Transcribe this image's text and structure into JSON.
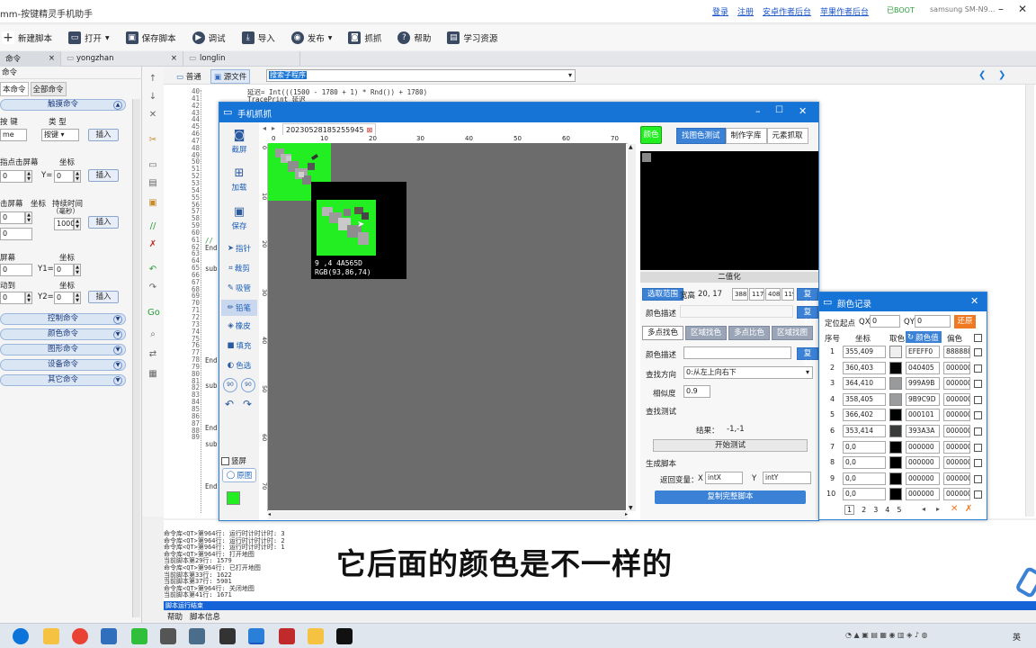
{
  "titlebar": {
    "title": "mm-按键精灵手机助手",
    "links": [
      "登录",
      "注册",
      "安卓作者后台",
      "苹果作者后台"
    ],
    "boot": "已BOOT",
    "device": "samsung  SM-N9..."
  },
  "toolbar": {
    "items": [
      {
        "icon": "plus-icon",
        "label": "新建脚本"
      },
      {
        "icon": "folder-icon",
        "label": "打开"
      },
      {
        "icon": "save-icon",
        "label": "保存脚本"
      },
      {
        "icon": "play-icon",
        "label": "调试"
      },
      {
        "icon": "import-icon",
        "label": "导入"
      },
      {
        "icon": "publish-icon",
        "label": "发布"
      },
      {
        "icon": "camera-icon",
        "label": "抓抓"
      },
      {
        "icon": "help-icon",
        "label": "帮助"
      },
      {
        "icon": "book-icon",
        "label": "学习资源"
      }
    ]
  },
  "tabs": [
    {
      "label": "命令",
      "close": "×"
    },
    {
      "label": "yongzhan",
      "close": "×"
    },
    {
      "label": "longlin",
      "close": ""
    }
  ],
  "leftpanel": {
    "header": "命令",
    "subtabs": [
      "本命令",
      "全部命令"
    ],
    "sections": {
      "touch": "触摸命令",
      "control": "控制命令",
      "color": "颜色命令",
      "graphic": "图形命令",
      "device": "设备命令",
      "other": "其它命令"
    },
    "insert_label": "插入",
    "labels": {
      "key": "按 键",
      "type": "类 型",
      "key_val": "me",
      "type_val": "按键",
      "tap_screen": "指点击屏幕",
      "coord": "坐标",
      "y_eq": "Y=",
      "x0": "0",
      "y0": "0",
      "press_screen": "击屏幕",
      "coord2": "坐标",
      "duration": "持续时间",
      "duration_unit": "（毫秒）",
      "duration_val": "1000",
      "screen": "屏幕",
      "coord3": "坐标",
      "y1": "Y1=",
      "coord4": "坐标",
      "move": "动到",
      "y2": "Y2="
    }
  },
  "editor": {
    "header": {
      "normal_tab": "普通",
      "source_tab": "源文件",
      "dropdown": "搜索子程序"
    },
    "line_numbers": [
      "40",
      "41",
      "42",
      "43",
      "44",
      "45",
      "46",
      "47",
      "48",
      "49",
      "50",
      "51",
      "52",
      "53",
      "54",
      "55",
      "56",
      "57",
      "58",
      "59",
      "60",
      "61",
      "62",
      "63",
      "64",
      "65",
      "66",
      "67",
      "68",
      "69",
      "70",
      "71",
      "72",
      "73",
      "74",
      "75",
      "76",
      "77",
      "78",
      "79",
      "80",
      "81",
      "82",
      "83",
      "84",
      "85",
      "86",
      "87",
      "88",
      "89"
    ],
    "code_top": [
      "  延迟= Int(((1500 - 1780 + 1) * Rnd()) + 1780)",
      "  TracePrint 延迟"
    ],
    "code_fragments": {
      "comment": "//",
      "end1": "End",
      "sub1": "sub",
      "end2": "End",
      "sub2": "sub",
      "end3": "End",
      "sub3": "sub",
      "end4": "End"
    }
  },
  "capture_window": {
    "title": "手机抓抓",
    "file_tab": "20230528185255945",
    "tools": [
      "截屏",
      "加载",
      "保存",
      "指针",
      "裁剪",
      "吸管",
      "铅笔",
      "橡皮",
      "填充",
      "色选"
    ],
    "vertical_checkbox": "竖屏",
    "original_btn": "原图",
    "ruler_top": [
      "0",
      "10",
      "20",
      "30",
      "40",
      "50",
      "60",
      "70"
    ],
    "ruler_left": [
      "0",
      "10",
      "20",
      "30",
      "40",
      "50",
      "60",
      "70",
      "80"
    ],
    "magnifier": {
      "line1": "9 ,4  4A565D",
      "line2": "RGB(93,86,74)"
    },
    "right": {
      "color_btn": "颜色",
      "tabs": [
        "找图色测试",
        "制作字库",
        "元素抓取"
      ],
      "binarize": "二值化",
      "select_range": "选取范围",
      "wh_label": "宽高",
      "wh_val": "20, 17",
      "range_vals": [
        "388",
        "117",
        "408",
        "119"
      ],
      "copy": "复制",
      "color_desc": "颜色描述",
      "multi_find": "多点找色",
      "region_find": "区域找色",
      "multi_compare": "多点比色",
      "region_find_img": "区域找图",
      "color_desc2": "颜色描述",
      "find_dir_label": "查找方向",
      "find_dir_val": "0:从左上向右下",
      "similarity_label": "相似度",
      "similarity_val": "0.9",
      "find_test": "查找测试",
      "result_label": "结果：",
      "result_val": "-1,-1",
      "start_test": "开始测试",
      "gen_script": "生成脚本",
      "return_var": "返回变量：",
      "x_label": "X",
      "x_val": "intX",
      "y_label": "Y",
      "y_val": "intY",
      "copy_script": "复制完整脚本"
    }
  },
  "color_window": {
    "title": "颜色记录",
    "origin_label": "定位起点",
    "qx_label": "QX",
    "qx_val": "0",
    "qy_label": "QY",
    "qy_val": "0",
    "restore": "还原",
    "headers": [
      "序号",
      "坐标",
      "取色",
      "颜色值",
      "偏色"
    ],
    "rows": [
      {
        "n": "1",
        "coord": "355,409",
        "color": "#EFEFF0",
        "hex": "EFEFF0",
        "off": "888888"
      },
      {
        "n": "2",
        "coord": "360,403",
        "color": "#040405",
        "hex": "040405",
        "off": "000000"
      },
      {
        "n": "3",
        "coord": "364,410",
        "color": "#999A9B",
        "hex": "999A9B",
        "off": "000000"
      },
      {
        "n": "4",
        "coord": "358,405",
        "color": "#9B9C9D",
        "hex": "9B9C9D",
        "off": "000000"
      },
      {
        "n": "5",
        "coord": "366,402",
        "color": "#000101",
        "hex": "000101",
        "off": "000000"
      },
      {
        "n": "6",
        "coord": "353,414",
        "color": "#393A3A",
        "hex": "393A3A",
        "off": "000000"
      },
      {
        "n": "7",
        "coord": "0,0",
        "color": "#000000",
        "hex": "000000",
        "off": "000000"
      },
      {
        "n": "8",
        "coord": "0,0",
        "color": "#000000",
        "hex": "000000",
        "off": "000000"
      },
      {
        "n": "9",
        "coord": "0,0",
        "color": "#000000",
        "hex": "000000",
        "off": "000000"
      },
      {
        "n": "10",
        "coord": "0,0",
        "color": "#000000",
        "hex": "000000",
        "off": "000000"
      }
    ],
    "pages": [
      "1",
      "2",
      "3",
      "4",
      "5"
    ]
  },
  "log": {
    "lines": [
      "命令库<QT>第964行: 运行时计时计时: 3",
      "命令库<QT>第964行: 运行时计时计时: 2",
      "命令库<QT>第964行: 运行时计时计时: 1",
      "命令库<QT>第964行: 打开地图",
      "当前脚本第29行: 1579",
      "命令库<QT>第964行: 已打开地图",
      "当前脚本第33行: 1622",
      "当前脚本第37行: 5901",
      "命令库<QT>第964行: 关闭地图",
      "当前脚本第41行: 1671"
    ],
    "status": "脚本运行结束",
    "tabs": [
      "帮助",
      "脚本信息"
    ]
  },
  "subtitle": "它后面的颜色是不一样的",
  "taskbar": {
    "ime": "英"
  },
  "colors": {
    "accent": "#1674D6",
    "green": "#22EE22"
  }
}
